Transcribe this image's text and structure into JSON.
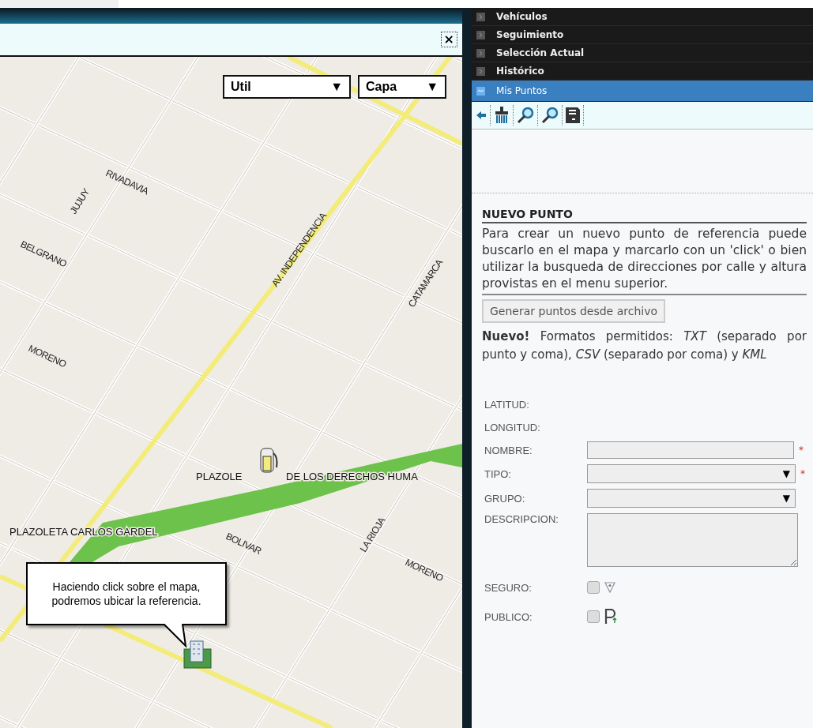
{
  "map_window": {
    "close_label": "×",
    "dropdowns": [
      {
        "label": "Util",
        "arrow": "▼"
      },
      {
        "label": "Capa",
        "arrow": "▼"
      }
    ],
    "street_labels": [
      "JUJUY",
      "RIVADAVIA",
      "BELGRANO",
      "AV. INDEPENDENCIA",
      "CATAMARCA",
      "MORENO",
      "LA RIOJA",
      "MORENO",
      "BOLIVAR"
    ],
    "place_labels": [
      "PLAZOLE",
      "DE LOS DERECHOS HUMA",
      "PLAZOLETA CARLOS GARDEL"
    ],
    "callout": "Haciendo click sobre el mapa, podremos ubicar la referencia."
  },
  "accordion": [
    {
      "label": "Vehículos",
      "expanded": false
    },
    {
      "label": "Seguimiento",
      "expanded": false
    },
    {
      "label": "Selección Actual",
      "expanded": false
    },
    {
      "label": "Histórico",
      "expanded": false
    },
    {
      "label": "Mis Puntos",
      "expanded": true
    }
  ],
  "section_title": "NUEVO PUNTO",
  "intro": "Para crear un nuevo punto de referencia puede buscarlo en el mapa y marcarlo con un 'click' o bien utilizar la busqueda de direcciones por calle y altura provistas en el menu superior.",
  "import_button": "Generar puntos desde archivo",
  "formats_note": "**Nuevo!** Formatos permitidos: *TXT* (separado por punto y coma), *CSV* (separado por coma) y *KML*",
  "form": [
    {
      "kind": "readonly",
      "label": "LATITUD:"
    },
    {
      "kind": "readonly",
      "label": "LONGITUD:"
    },
    {
      "kind": "text",
      "label": "NOMBRE:",
      "required": true
    },
    {
      "kind": "select",
      "label": "TIPO:",
      "required": true,
      "arrow": "▼"
    },
    {
      "kind": "select",
      "label": "GRUPO:",
      "arrow": "▼"
    },
    {
      "kind": "textarea",
      "label": "DESCRIPCION:"
    },
    {
      "kind": "checkbox",
      "label": "SEGURO:",
      "checked": false
    },
    {
      "kind": "checkbox",
      "label": "PUBLICO:",
      "checked": false
    }
  ],
  "required_mark": "*"
}
